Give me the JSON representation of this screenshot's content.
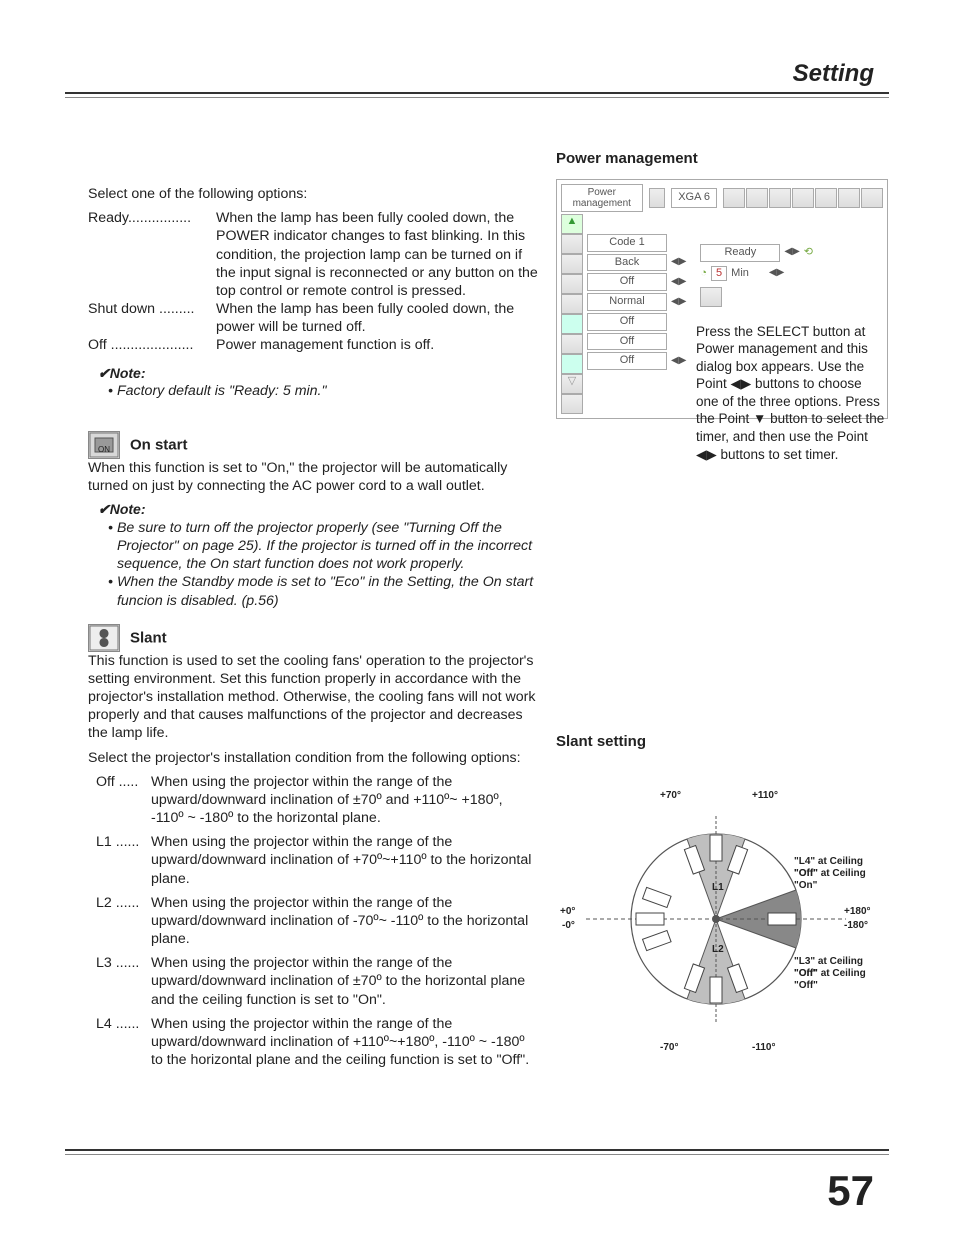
{
  "header": {
    "title": "Setting"
  },
  "page_number": "57",
  "left": {
    "intro": "Select one of the following options:",
    "opts": [
      {
        "term": "Ready",
        "dots": "................",
        "desc": "When the lamp has been fully cooled down, the POWER indicator changes to fast blinking. In this condition, the projection lamp can be turned on if the input signal is reconnected or any button on the top control or remote control is pressed."
      },
      {
        "term": "Shut down",
        "dots": ".........",
        "desc": "When the lamp has been fully cooled down, the power will be turned off."
      },
      {
        "term": "Off",
        "dots": ".....................",
        "desc": "Power management function is off."
      }
    ],
    "note1_head": "✔Note:",
    "note1_body": "Factory default is \"Ready: 5 min.\"",
    "onstart": {
      "title": "On start",
      "body": "When this function is set to \"On,\" the projector will be automatically turned on just by connecting the AC power cord to a wall outlet."
    },
    "note2_head": "✔Note:",
    "note2_items": [
      "Be sure to turn off the projector properly (see \"Turning Off the Projector\" on page 25). If the projector is turned off in the incorrect sequence, the On start function does not work properly.",
      "When the Standby mode is set to \"Eco\" in the Setting, the On start funcion is disabled. (p.56)"
    ],
    "slant": {
      "title": "Slant",
      "p1": "This function is used to set the cooling fans' operation to the projector's setting environment. Set this function properly in accordance with the projector's installation method. Otherwise, the cooling fans will not work properly and that causes malfunctions of the projector and decreases the lamp life.",
      "p2": "Select the projector's installation condition from the following options:",
      "opts": [
        {
          "k": "Off .....",
          "v": "When using the projector within the range of the upward/downward inclination of ±70º and +110º~ +180º, -110º ~ -180º to the horizontal plane."
        },
        {
          "k": "L1 ......",
          "v": "When using the projector within the range of the upward/downward inclination of +70º~+110º to the horizontal plane."
        },
        {
          "k": "L2 ......",
          "v": "When using the projector within the range of the upward/downward inclination of -70º~ -110º to the horizontal plane."
        },
        {
          "k": "L3 ......",
          "v": "When using the projector within the range of the upward/downward inclination of ±70º to the horizontal plane and the ceiling function is set to \"On\"."
        },
        {
          "k": "L4 ......",
          "v": "When using the projector within the range of the upward/downward inclination of +110º~+180º, -110º ~ -180º to the horizontal plane and the ceiling function is set to \"Off\"."
        }
      ]
    }
  },
  "right": {
    "pm_title": "Power management",
    "ui": {
      "title_l": "Power management",
      "title_r": "XGA 6",
      "list": [
        "Code 1",
        "Back",
        "Off",
        "Normal",
        "Off",
        "Off",
        "Off"
      ],
      "bubble_top": "Ready",
      "bubble_min_val": "5",
      "bubble_min_unit": "Min"
    },
    "caption_pm": "Press the SELECT button at Power management and this dialog box appears. Use the Point ◀▶ buttons to choose one of the three options. Press the Point ▼ button to select the timer, and then use the Point ◀▶ buttons to set timer.",
    "slant_title": "Slant setting",
    "diag": {
      "t70": "+70°",
      "t110": "+110°",
      "b70": "-70°",
      "b110": "-110°",
      "l0t": "+0°",
      "l0b": "-0°",
      "r180t": "+180°",
      "r180b": "-180°",
      "L1": "L1",
      "L2": "L2",
      "lab_l4a": "\"L4\" at Ceiling \"Off\"",
      "lab_l4b": "\"Off\" at Ceiling \"On\"",
      "lab_l3a": "\"L3\" at Ceiling \"On\"",
      "lab_l3b": "\"Off\" at Ceiling \"Off\""
    }
  }
}
